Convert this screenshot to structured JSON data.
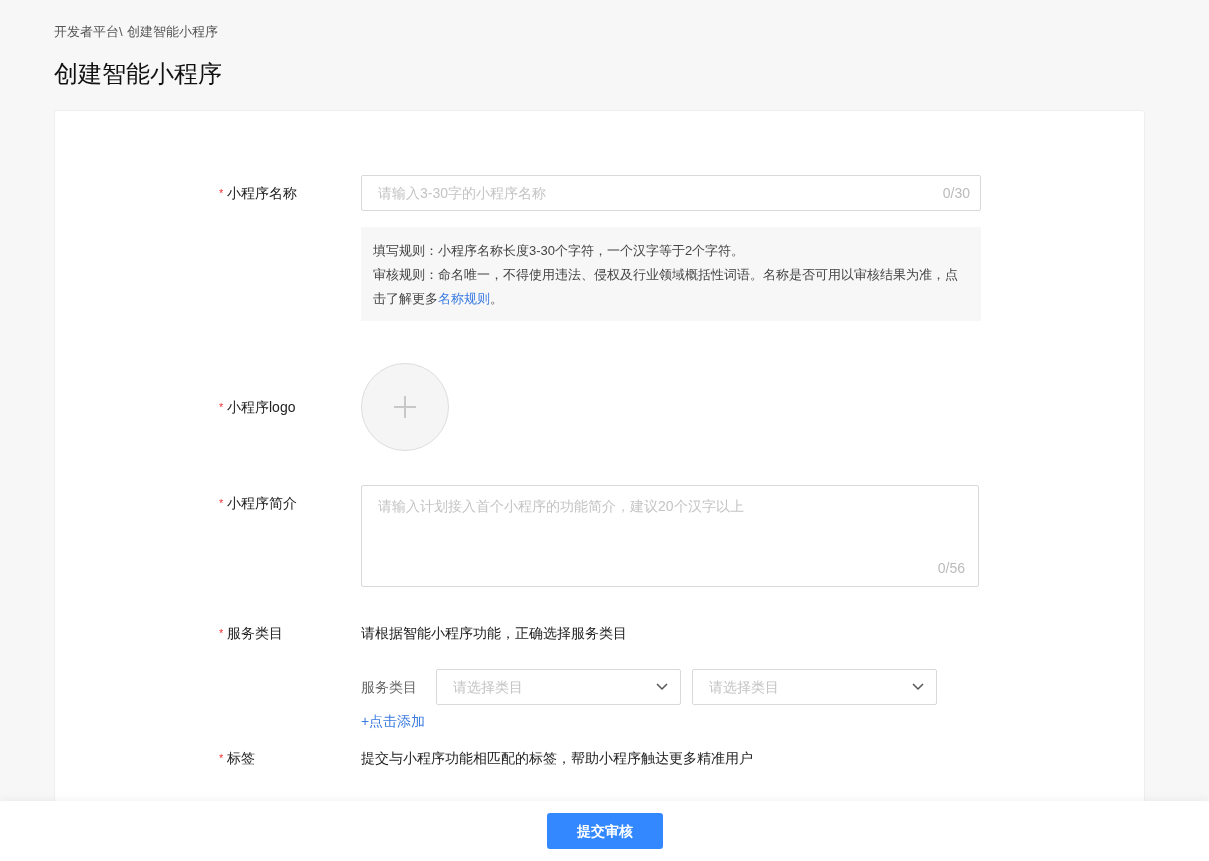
{
  "breadcrumb": {
    "items": [
      "开发者平台\\",
      "创建智能小程序"
    ]
  },
  "page_title": "创建智能小程序",
  "form": {
    "name_field": {
      "label": "小程序名称",
      "required_mark": "*",
      "placeholder": "请输入3-30字的小程序名称",
      "counter": "0/30"
    },
    "name_rules": [
      {
        "text": "填写规则：小程序名称长度3-30个字符，一个汉字等于2个字符。"
      },
      {
        "text": "审核规则：命名唯一，不得使用违法、侵权及行业领域概括性词语。名称是否可用以审核结果为准，点击了解更多",
        "link": "名称规则",
        "after": "。"
      }
    ],
    "logo_field": {
      "label": "小程序logo",
      "required_mark": "*"
    },
    "intro_field": {
      "label": "小程序简介",
      "required_mark": "*",
      "placeholder": "请输入计划接入首个小程序的功能简介，建议20个汉字以上",
      "counter": "0/56"
    },
    "category_field": {
      "label": "服务类目",
      "required_mark": "*",
      "hint": "请根据智能小程序功能，正确选择服务类目",
      "row_label": "服务类目",
      "selects": [
        {
          "placeholder": "请选择类目"
        },
        {
          "placeholder": "请选择类目"
        }
      ],
      "add_link": "+点击添加"
    },
    "tag_field": {
      "label": "标签",
      "required_mark": "*",
      "hint": "提交与小程序功能相匹配的标签，帮助小程序触达更多精准用户"
    }
  },
  "footer": {
    "submit_button": "提交审核"
  }
}
